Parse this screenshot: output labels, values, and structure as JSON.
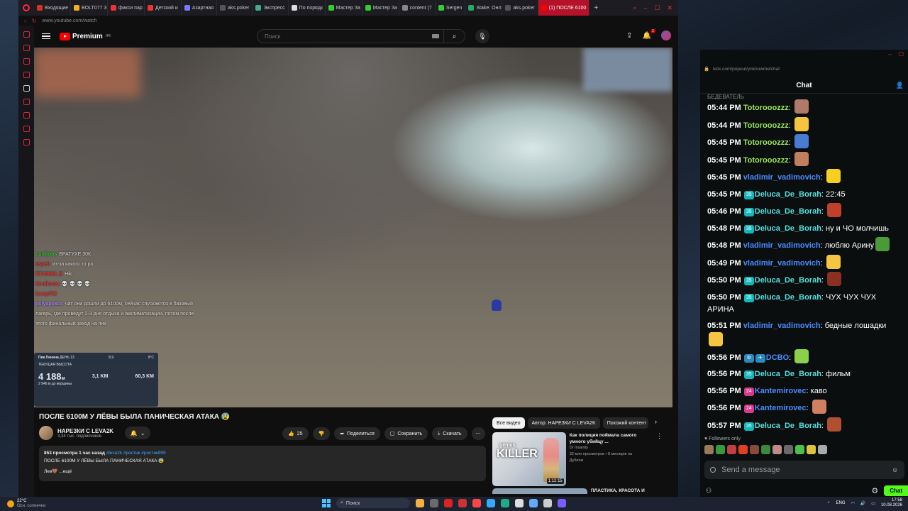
{
  "browser": {
    "tabs": [
      {
        "label": "Входящие",
        "color": "#d93025"
      },
      {
        "label": "BOLT077 3",
        "color": "#f2b01e"
      },
      {
        "label": "фикси пар",
        "color": "#e33"
      },
      {
        "label": "Детский и",
        "color": "#e33"
      },
      {
        "label": "Азартная",
        "color": "#7a7aff"
      },
      {
        "label": "aks.poker",
        "color": "#555"
      },
      {
        "label": "Экспресс",
        "color": "#4a8"
      },
      {
        "label": "По порядк",
        "color": "#ddd"
      },
      {
        "label": "Мастер За",
        "color": "#3c3"
      },
      {
        "label": "Мастер За",
        "color": "#3c3"
      },
      {
        "label": "content (7",
        "color": "#888"
      },
      {
        "label": "Sergen",
        "color": "#3c3"
      },
      {
        "label": "Stake: Онл",
        "color": "#2a6"
      },
      {
        "label": "aks.poker",
        "color": "#555"
      },
      {
        "label": "(1) ПОСЛЕ 6100",
        "color": "#f00"
      }
    ],
    "new_tab": "+",
    "url": "www.youtube.com/watch"
  },
  "youtube": {
    "logo_text": "Premium",
    "logo_region": "HR",
    "search_placeholder": "Поиск",
    "notif_count": "1",
    "chat_overlay": [
      {
        "user": "Luntrobs",
        "text": "БРАТУХЕ 30К",
        "color": "#3c3"
      },
      {
        "user": "uspeh",
        "text": "из-за какого то ро",
        "color": "#e33"
      },
      {
        "user": "RTX5090_E",
        "text": "Hik",
        "color": "#e33"
      },
      {
        "user": "Knolkoma",
        "text": "💀 💀 💀 💀",
        "color": "#e33"
      },
      {
        "user": "kemp756",
        "text": "",
        "color": "#e33"
      },
      {
        "user": "polyxpoxoc",
        "text": "чат они дошли до 6100м, сейчас спускаются в базовый лагерь, где проведут 2-3 дня отдыха и акклиматизации, потом после этого финальный заход на пик",
        "color": "#a8f"
      }
    ],
    "stats": {
      "peak": "Пик Ленина",
      "day": "ДЕНЬ 13",
      "speed": "8,9",
      "temp": "9°C",
      "height_label": "ТЕКУЩАЯ ВЫСОТА",
      "height": "4 188",
      "height_unit": "м",
      "today": "3,1 KM",
      "total": "60,3 KM",
      "remaining": "2 946 м до вершины"
    },
    "title": "ПОСЛЕ 6100М У ЛЁВЫ БЫЛА ПАНИЧЕСКАЯ АТАКА 😰",
    "channel": "НАРЕЗКИ С LEVA2K",
    "subs": "3,34 тыс. подписчиков",
    "likes": "25",
    "share": "Поделиться",
    "save": "Сохранить",
    "download": "Скачать",
    "desc_meta": "853 просмотра  1 час назад",
    "desc_tags": "#leva2k #ростик #ростик999",
    "desc_title": "ПОСЛЕ 6100М У ЛЁВЫ БЫЛА ПАНИЧЕСКАЯ АТАКА 😰",
    "desc_line": "Лев🤎 ...ещё",
    "chips": [
      "Все видео",
      "Автор: НАРЕЗКИ С LEVA2K",
      "Похожий контент"
    ],
    "rec": {
      "thumb_small": "genius",
      "thumb_big": "KILLER",
      "duration": "1:12:15",
      "title": "Как полиция поймала самого умного убийцу ...",
      "channel": "Dr Insanity",
      "meta": "32 млн просмотров • 8 месяцев на",
      "tag": "Дубляж"
    },
    "rec2_title": "ПЛАСТИКА, КРАСОТА И"
  },
  "kick": {
    "url": "kick.com/popout/ynknowme/chat",
    "header": "Chat",
    "cut_line": "БЕДЕВАТЕЛЬ",
    "messages": [
      {
        "time": "05:44 PM",
        "user": "Totorooozzz",
        "sep": ":",
        "text": "",
        "ucolor": "#9ee65a",
        "emote": "#b07a6a"
      },
      {
        "time": "05:44 PM",
        "user": "Totorooozzz",
        "sep": ":",
        "text": "",
        "ucolor": "#9ee65a",
        "emote": "#f5c542"
      },
      {
        "time": "05:45 PM",
        "user": "Totorooozzz",
        "sep": ":",
        "text": "",
        "ucolor": "#9ee65a",
        "emote": "#4a7bd0"
      },
      {
        "time": "05:45 PM",
        "user": "Totorooozzz",
        "sep": ":",
        "text": "",
        "ucolor": "#9ee65a",
        "emote": "#c08060"
      },
      {
        "time": "05:45 PM",
        "user": "vladimir_vadimovich",
        "sep": ":",
        "text": "",
        "ucolor": "#4a8cff",
        "emote": "#f5d020"
      },
      {
        "time": "05:45 PM",
        "badge": "35",
        "bcolor": "#15b8b8",
        "user": "Deluca_De_Borah",
        "sep": ":",
        "text": "22:45",
        "ucolor": "#54e0e0"
      },
      {
        "time": "05:46 PM",
        "badge": "35",
        "bcolor": "#15b8b8",
        "user": "Deluca_De_Borah",
        "sep": ":",
        "text": "",
        "ucolor": "#54e0e0",
        "emote": "#c0402a"
      },
      {
        "time": "05:48 PM",
        "badge": "35",
        "bcolor": "#15b8b8",
        "user": "Deluca_De_Borah",
        "sep": ":",
        "text": "ну и ЧО молчишь",
        "ucolor": "#54e0e0"
      },
      {
        "time": "05:48 PM",
        "user": "vladimir_vadimovich",
        "sep": ":",
        "text": "люблю Арину",
        "ucolor": "#4a8cff",
        "emote": "#4a9a3a"
      },
      {
        "time": "05:49 PM",
        "user": "vladimir_vadimovich",
        "sep": ":",
        "text": "",
        "ucolor": "#4a8cff",
        "emote": "#f5c542"
      },
      {
        "time": "05:50 PM",
        "badge": "35",
        "bcolor": "#15b8b8",
        "user": "Deluca_De_Borah",
        "sep": ":",
        "text": "",
        "ucolor": "#54e0e0",
        "emote": "#8a3020"
      },
      {
        "time": "05:50 PM",
        "badge": "35",
        "bcolor": "#15b8b8",
        "user": "Deluca_De_Borah",
        "sep": ":",
        "text": "ЧУХ ЧУХ ЧУХ АРИНА",
        "ucolor": "#54e0e0",
        "wrap": true
      },
      {
        "time": "05:51 PM",
        "user": "vladimir_vadimovich",
        "sep": ":",
        "text": "бедные лошадки",
        "ucolor": "#4a8cff",
        "emote": "#f5c542",
        "wrap": true
      },
      {
        "time": "05:56 PM",
        "badge": "⚙",
        "bcolor": "#2a8ac0",
        "badge2": "✈",
        "user": "DCBO",
        "sep": ":",
        "text": "",
        "ucolor": "#4a8cff",
        "emote": "#8ad04a"
      },
      {
        "time": "05:56 PM",
        "badge": "35",
        "bcolor": "#15b8b8",
        "user": "Deluca_De_Borah",
        "sep": ":",
        "text": "фильм",
        "ucolor": "#54e0e0"
      },
      {
        "time": "05:56 PM",
        "badge": "24",
        "bcolor": "#d63a8a",
        "user": "Kantemirovec",
        "sep": ":",
        "text": "каво",
        "ucolor": "#4a8cff"
      },
      {
        "time": "05:56 PM",
        "badge": "24",
        "bcolor": "#d63a8a",
        "user": "Kantemirovec",
        "sep": ":",
        "text": "",
        "ucolor": "#4a8cff",
        "emote": "#d08060"
      },
      {
        "time": "05:57 PM",
        "badge": "35",
        "bcolor": "#15b8b8",
        "user": "Deluca_De_Borah",
        "sep": ":",
        "text": "",
        "ucolor": "#54e0e0",
        "emote": "#b05030"
      }
    ],
    "followers_only": "Followers only",
    "emote_bar": [
      "#9a7a5a",
      "#3a9a3a",
      "#c04040",
      "#e04020",
      "#8a4a3a",
      "#3a8a3a",
      "#c08a8a",
      "#6a6a6a",
      "#4ac04a",
      "#e0c040",
      "#aaa"
    ],
    "input_placeholder": "Send a message",
    "chat_button": "Chat"
  },
  "taskbar": {
    "temp": "22°C",
    "weather": "Осн. солнечно",
    "search": "Поиск",
    "apps": [
      "#f5b042",
      "#6a6a6a",
      "#d22",
      "#c33",
      "#f44",
      "#3af",
      "#2a8",
      "#ddd",
      "#6af",
      "#ccc",
      "#7a5cff"
    ],
    "lang": "ENG",
    "time": "17:58",
    "date": "10.08.2026"
  }
}
